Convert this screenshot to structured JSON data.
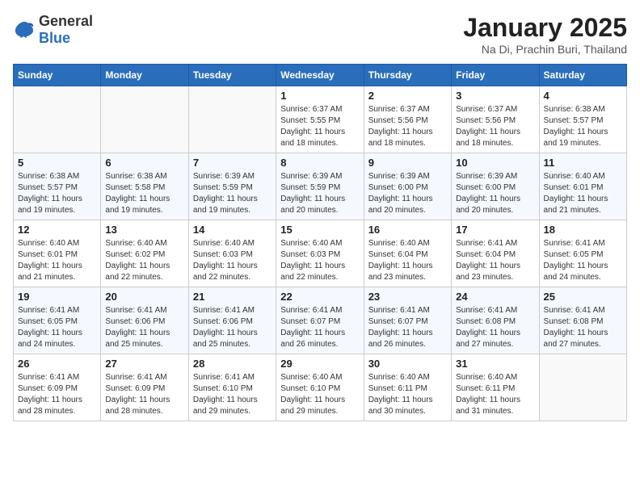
{
  "logo": {
    "general": "General",
    "blue": "Blue"
  },
  "header": {
    "title": "January 2025",
    "subtitle": "Na Di, Prachin Buri, Thailand"
  },
  "days_of_week": [
    "Sunday",
    "Monday",
    "Tuesday",
    "Wednesday",
    "Thursday",
    "Friday",
    "Saturday"
  ],
  "weeks": [
    [
      {
        "day": null,
        "info": null
      },
      {
        "day": null,
        "info": null
      },
      {
        "day": null,
        "info": null
      },
      {
        "day": "1",
        "info": "Sunrise: 6:37 AM\nSunset: 5:55 PM\nDaylight: 11 hours and 18 minutes."
      },
      {
        "day": "2",
        "info": "Sunrise: 6:37 AM\nSunset: 5:56 PM\nDaylight: 11 hours and 18 minutes."
      },
      {
        "day": "3",
        "info": "Sunrise: 6:37 AM\nSunset: 5:56 PM\nDaylight: 11 hours and 18 minutes."
      },
      {
        "day": "4",
        "info": "Sunrise: 6:38 AM\nSunset: 5:57 PM\nDaylight: 11 hours and 19 minutes."
      }
    ],
    [
      {
        "day": "5",
        "info": "Sunrise: 6:38 AM\nSunset: 5:57 PM\nDaylight: 11 hours and 19 minutes."
      },
      {
        "day": "6",
        "info": "Sunrise: 6:38 AM\nSunset: 5:58 PM\nDaylight: 11 hours and 19 minutes."
      },
      {
        "day": "7",
        "info": "Sunrise: 6:39 AM\nSunset: 5:59 PM\nDaylight: 11 hours and 19 minutes."
      },
      {
        "day": "8",
        "info": "Sunrise: 6:39 AM\nSunset: 5:59 PM\nDaylight: 11 hours and 20 minutes."
      },
      {
        "day": "9",
        "info": "Sunrise: 6:39 AM\nSunset: 6:00 PM\nDaylight: 11 hours and 20 minutes."
      },
      {
        "day": "10",
        "info": "Sunrise: 6:39 AM\nSunset: 6:00 PM\nDaylight: 11 hours and 20 minutes."
      },
      {
        "day": "11",
        "info": "Sunrise: 6:40 AM\nSunset: 6:01 PM\nDaylight: 11 hours and 21 minutes."
      }
    ],
    [
      {
        "day": "12",
        "info": "Sunrise: 6:40 AM\nSunset: 6:01 PM\nDaylight: 11 hours and 21 minutes."
      },
      {
        "day": "13",
        "info": "Sunrise: 6:40 AM\nSunset: 6:02 PM\nDaylight: 11 hours and 22 minutes."
      },
      {
        "day": "14",
        "info": "Sunrise: 6:40 AM\nSunset: 6:03 PM\nDaylight: 11 hours and 22 minutes."
      },
      {
        "day": "15",
        "info": "Sunrise: 6:40 AM\nSunset: 6:03 PM\nDaylight: 11 hours and 22 minutes."
      },
      {
        "day": "16",
        "info": "Sunrise: 6:40 AM\nSunset: 6:04 PM\nDaylight: 11 hours and 23 minutes."
      },
      {
        "day": "17",
        "info": "Sunrise: 6:41 AM\nSunset: 6:04 PM\nDaylight: 11 hours and 23 minutes."
      },
      {
        "day": "18",
        "info": "Sunrise: 6:41 AM\nSunset: 6:05 PM\nDaylight: 11 hours and 24 minutes."
      }
    ],
    [
      {
        "day": "19",
        "info": "Sunrise: 6:41 AM\nSunset: 6:05 PM\nDaylight: 11 hours and 24 minutes."
      },
      {
        "day": "20",
        "info": "Sunrise: 6:41 AM\nSunset: 6:06 PM\nDaylight: 11 hours and 25 minutes."
      },
      {
        "day": "21",
        "info": "Sunrise: 6:41 AM\nSunset: 6:06 PM\nDaylight: 11 hours and 25 minutes."
      },
      {
        "day": "22",
        "info": "Sunrise: 6:41 AM\nSunset: 6:07 PM\nDaylight: 11 hours and 26 minutes."
      },
      {
        "day": "23",
        "info": "Sunrise: 6:41 AM\nSunset: 6:07 PM\nDaylight: 11 hours and 26 minutes."
      },
      {
        "day": "24",
        "info": "Sunrise: 6:41 AM\nSunset: 6:08 PM\nDaylight: 11 hours and 27 minutes."
      },
      {
        "day": "25",
        "info": "Sunrise: 6:41 AM\nSunset: 6:08 PM\nDaylight: 11 hours and 27 minutes."
      }
    ],
    [
      {
        "day": "26",
        "info": "Sunrise: 6:41 AM\nSunset: 6:09 PM\nDaylight: 11 hours and 28 minutes."
      },
      {
        "day": "27",
        "info": "Sunrise: 6:41 AM\nSunset: 6:09 PM\nDaylight: 11 hours and 28 minutes."
      },
      {
        "day": "28",
        "info": "Sunrise: 6:41 AM\nSunset: 6:10 PM\nDaylight: 11 hours and 29 minutes."
      },
      {
        "day": "29",
        "info": "Sunrise: 6:40 AM\nSunset: 6:10 PM\nDaylight: 11 hours and 29 minutes."
      },
      {
        "day": "30",
        "info": "Sunrise: 6:40 AM\nSunset: 6:11 PM\nDaylight: 11 hours and 30 minutes."
      },
      {
        "day": "31",
        "info": "Sunrise: 6:40 AM\nSunset: 6:11 PM\nDaylight: 11 hours and 31 minutes."
      },
      {
        "day": null,
        "info": null
      }
    ]
  ]
}
